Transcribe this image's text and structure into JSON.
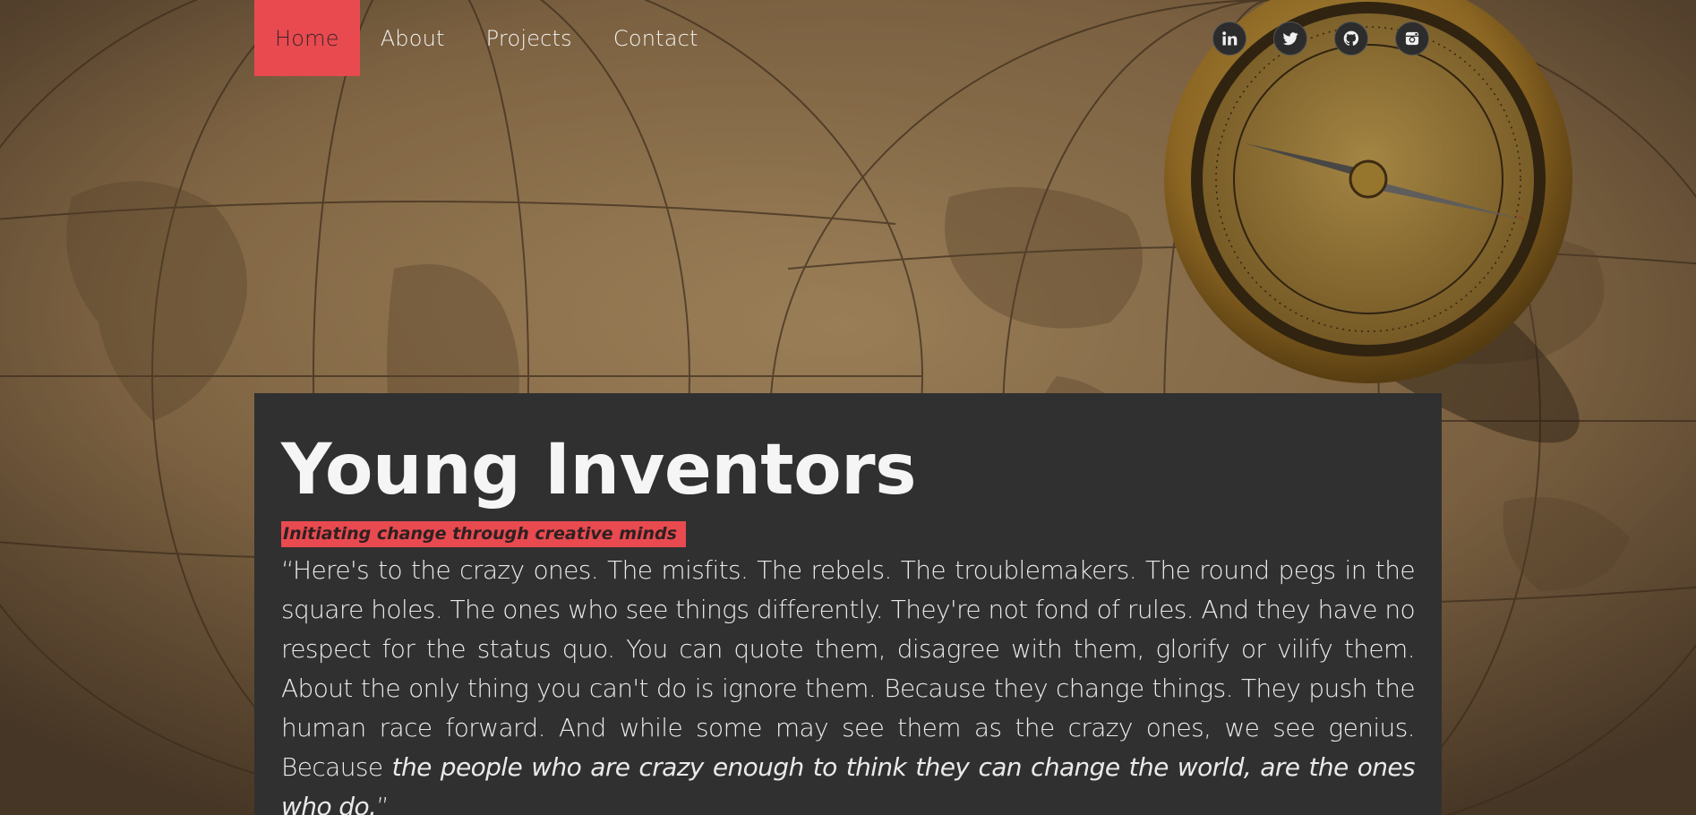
{
  "nav": {
    "items": [
      {
        "label": "Home",
        "active": true
      },
      {
        "label": "About",
        "active": false
      },
      {
        "label": "Projects",
        "active": false
      },
      {
        "label": "Contact",
        "active": false
      }
    ]
  },
  "social": [
    {
      "icon": "linkedin-icon"
    },
    {
      "icon": "twitter-icon"
    },
    {
      "icon": "github-icon"
    },
    {
      "icon": "instagram-icon"
    }
  ],
  "hero": {
    "title": "Young Inventors",
    "tagline": "Initiating change through creative minds",
    "quote_plain": "“Here's to the crazy ones. The misfits. The rebels. The troublemakers. The round pegs in the square holes. The ones who see things differently. They're not fond of rules. And they have no respect for the status quo. You can quote them, disagree with them, glorify or vilify them. About the only thing you can't do is ignore them. Because they change things. They push the human race forward. And while some may see them as the crazy ones, we see genius. Because ",
    "quote_italic": "the people who are crazy enough to think they can change the world, are the ones who do.",
    "quote_close": "”"
  },
  "colors": {
    "accent": "#e84a50",
    "card": "#303030",
    "text": "#f5f5f5"
  }
}
